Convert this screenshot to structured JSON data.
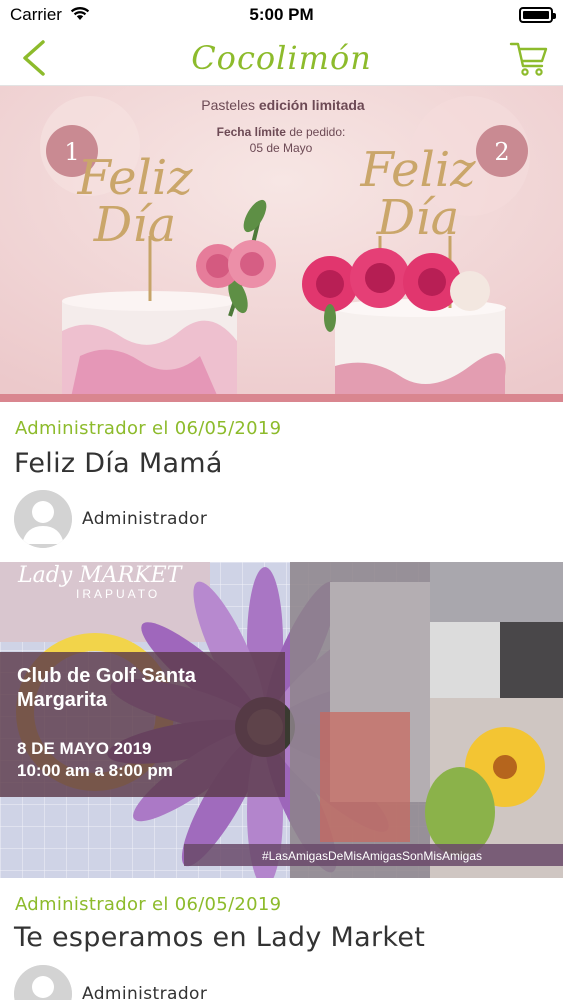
{
  "status_bar": {
    "carrier": "Carrier",
    "time": "5:00 PM"
  },
  "nav": {
    "title": "Cocolimón"
  },
  "posts": [
    {
      "meta": "Administrador el 06/05/2019",
      "title": "Feliz Día Mamá",
      "author": "Administrador",
      "image_text": {
        "header_light": "Pasteles",
        "header_bold": "edición limitada",
        "deadline_label_bold": "Fecha límite",
        "deadline_label_light": "de pedido:",
        "deadline_date": "05 de Mayo",
        "badge_1": "1",
        "badge_2": "2",
        "topper_line1": "Feliz",
        "topper_line2": "Día"
      }
    },
    {
      "meta": "Administrador el 06/05/2019",
      "title": "Te esperamos en Lady Market",
      "author": "Administrador",
      "image_text": {
        "brand": "Lady MARKET",
        "city": "IRAPUATO",
        "venue_line1": "Club de Golf Santa",
        "venue_line2": "Margarita",
        "date": "8 DE MAYO 2019",
        "hours": "10:00 am a 8:00 pm",
        "hashtag": "#LasAmigasDeMisAmigasSonMisAmigas"
      }
    }
  ],
  "colors": {
    "accent": "#8dbb2c",
    "text": "#333333",
    "pink_badge": "#c98a92",
    "event_overlay": "#5b3a4a"
  },
  "icons": {
    "back": "chevron-left-icon",
    "cart": "cart-icon",
    "wifi": "wifi-icon",
    "battery": "battery-icon",
    "avatar": "user-placeholder-icon"
  }
}
